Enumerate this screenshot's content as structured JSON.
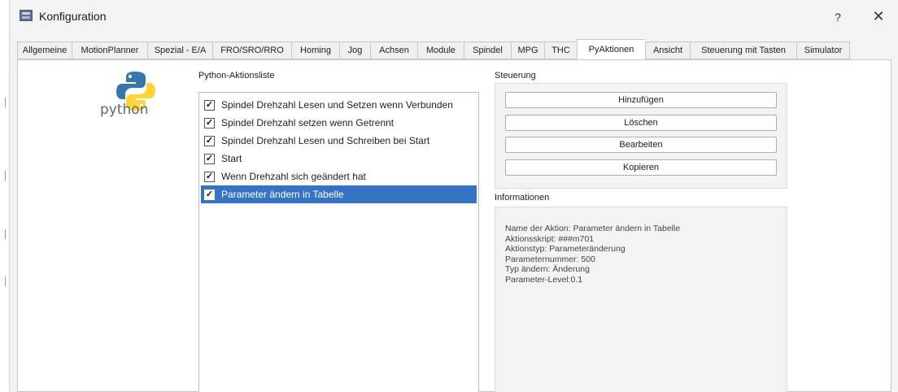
{
  "window": {
    "title": "Konfiguration",
    "help": "?",
    "close": "✕"
  },
  "tabs": [
    "Allgemeine",
    "MotionPlanner",
    "Spezial - E/A",
    "FRO/SRO/RRO",
    "Homing",
    "Jog",
    "Achsen",
    "Module",
    "Spindel",
    "MPG",
    "THC",
    "PyAktionen",
    "Ansicht",
    "Steuerung mit Tasten",
    "Simulator"
  ],
  "active_tab": "PyAktionen",
  "logo": {
    "word": "python",
    "colors": {
      "blue": "#3776ab",
      "yellow": "#ffd43b"
    }
  },
  "action_list": {
    "label": "Python-Aktionsliste",
    "items": [
      {
        "label": "Spindel Drehzahl Lesen und Setzen wenn Verbunden",
        "checked": "✓"
      },
      {
        "label": "Spindel Drehzahl setzen wenn Getrennt",
        "checked": "✓"
      },
      {
        "label": "Spindel Drehzahl Lesen und Schreiben bei Start",
        "checked": "✓"
      },
      {
        "label": "Start",
        "checked": "✓"
      },
      {
        "label": "Wenn Drehzahl sich geändert hat",
        "checked": "✓"
      },
      {
        "label": "Parameter ändern in Tabelle",
        "checked": "✓"
      }
    ],
    "selected": "Parameter ändern in Tabelle",
    "selection_color": "#3574c4"
  },
  "control": {
    "label": "Steuerung",
    "buttons": [
      "Hinzufügen",
      "Löschen",
      "Bearbeiten",
      "Kopieren"
    ]
  },
  "info": {
    "label": "Informationen",
    "lines": [
      "Name der Aktion: Parameter ändern in Tabelle",
      "Aktionsskript: ###m701",
      "Aktionstyp: Parameteränderung",
      "Parameternummer: 500",
      "Typ ändern: Änderung",
      "Parameter-Level:0.1"
    ]
  }
}
